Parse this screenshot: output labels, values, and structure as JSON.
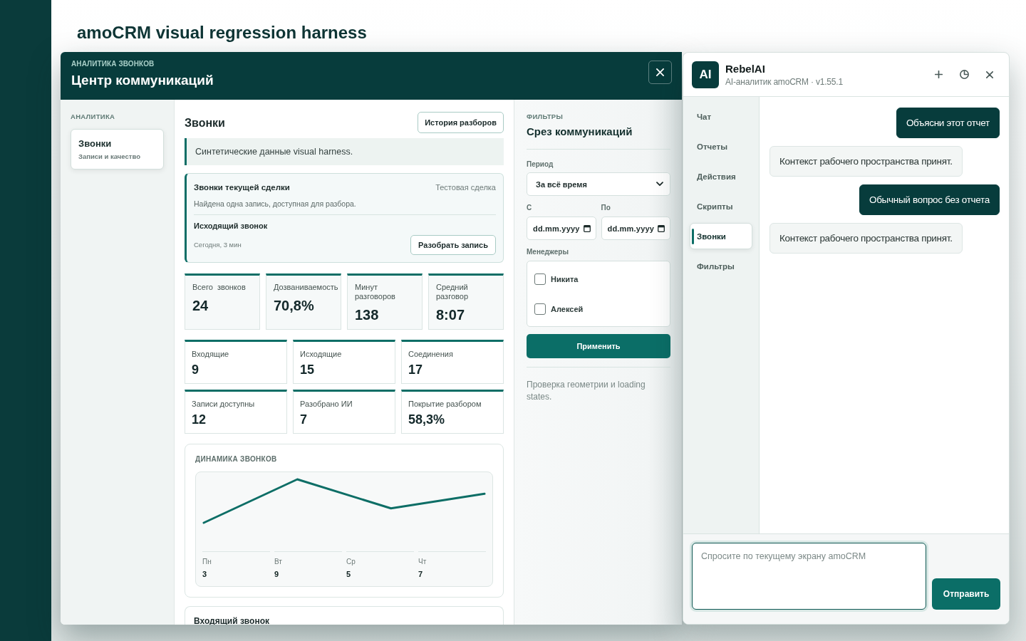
{
  "page": {
    "title": "amoCRM visual regression harness"
  },
  "modal": {
    "eyebrow": "АНАЛИТИКА ЗВОНКОВ",
    "title": "Центр коммуникаций",
    "nav": {
      "heading": "АНАЛИТИКА",
      "items": [
        {
          "title": "Звонки",
          "subtitle": "Записи и качество",
          "selected": true
        }
      ]
    },
    "main": {
      "title": "Звонки",
      "history_button": "История разборов",
      "notice": "Синтетические данные visual harness.",
      "deal_card": {
        "title": "Звонки текущей сделки",
        "deal": "Тестовая сделка",
        "summary": "Найдена одна запись, доступная для разбора.",
        "call_title": "Исходящий звонок",
        "call_meta": "Сегодня, 3 мин",
        "action_button": "Разобрать запись"
      },
      "primary_stats": [
        {
          "label": "Всего звонков",
          "value": "24"
        },
        {
          "label": "Дозваниваемость",
          "value": "70,8%"
        },
        {
          "label": "Минут разговоров",
          "value": "138"
        },
        {
          "label": "Средний разговор",
          "value": "8:07"
        }
      ],
      "secondary_stats": [
        {
          "label": "Входящие",
          "value": "9"
        },
        {
          "label": "Исходящие",
          "value": "15"
        },
        {
          "label": "Соединения",
          "value": "17"
        },
        {
          "label": "Записи доступны",
          "value": "12"
        },
        {
          "label": "Разобрано ИИ",
          "value": "7"
        },
        {
          "label": "Покрытие разбором",
          "value": "58,3%"
        }
      ],
      "trend": {
        "title": "ДИНАМИКА ЗВОНКОВ",
        "days": [
          {
            "label": "Пн",
            "value": "3"
          },
          {
            "label": "Вт",
            "value": "9"
          },
          {
            "label": "Ср",
            "value": "5"
          },
          {
            "label": "Чт",
            "value": "7"
          }
        ]
      },
      "next_card": {
        "title": "Входящий звонок"
      }
    },
    "filters": {
      "eyebrow": "ФИЛЬТРЫ",
      "title": "Срез коммуникаций",
      "period": {
        "label": "Период",
        "value": "За всё время"
      },
      "date_from": {
        "label": "С",
        "placeholder": "dd.mm.yyyy"
      },
      "date_to": {
        "label": "По",
        "placeholder": "dd.mm.yyyy"
      },
      "managers": {
        "label": "Менеджеры",
        "options": [
          {
            "label": "Никита",
            "checked": false
          },
          {
            "label": "Алексей",
            "checked": false
          }
        ]
      },
      "apply_button": "Применить",
      "note": "Проверка геометрии и loading states."
    }
  },
  "assistant": {
    "logo": "AI",
    "name": "RebelAI",
    "subtitle": "AI-аналитик amoCRM · v1.55.1",
    "tabs": [
      {
        "label": "Чат",
        "selected": false
      },
      {
        "label": "Отчеты",
        "selected": false
      },
      {
        "label": "Действия",
        "selected": false
      },
      {
        "label": "Скрипты",
        "selected": false
      },
      {
        "label": "Звонки",
        "selected": true
      },
      {
        "label": "Фильтры",
        "selected": false
      }
    ],
    "messages": [
      {
        "kind": "user",
        "text": "Объясни этот отчет"
      },
      {
        "kind": "assistant",
        "text": "Контекст рабочего пространства принят."
      },
      {
        "kind": "user",
        "text": "Обычный вопрос без отчета"
      },
      {
        "kind": "assistant",
        "text": "Контекст рабочего пространства принят."
      }
    ],
    "composer": {
      "placeholder": "Спросите по текущему экрану amoCRM",
      "send_button": "Отправить"
    }
  }
}
